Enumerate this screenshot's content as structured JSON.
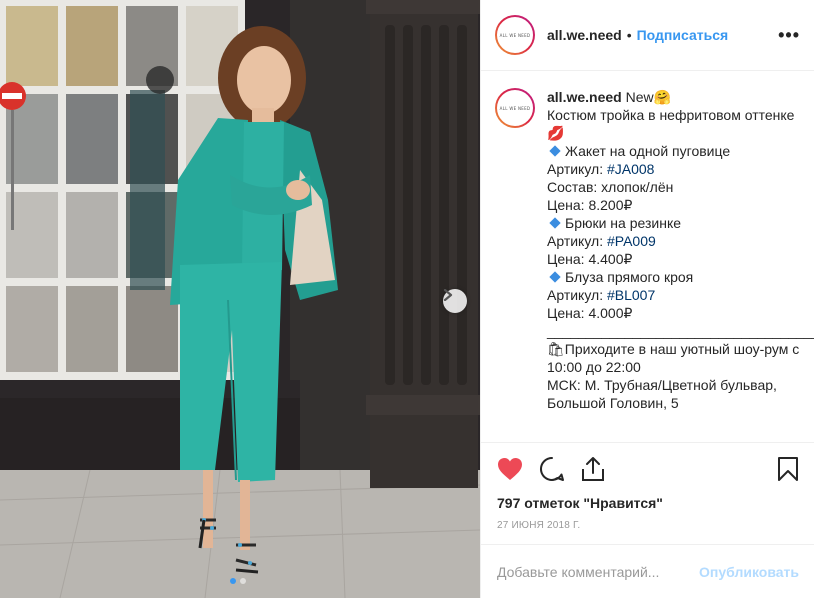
{
  "post": {
    "username": "all.we.need",
    "avatar_text": "ALL WE NEED",
    "follow_label": "Подписаться",
    "separator": "•",
    "more_label": "•••"
  },
  "caption": {
    "username": "all.we.need",
    "lines": [
      {
        "text": "New🤗"
      },
      {
        "text": "Костюм тройка в нефритовом оттенке💋"
      },
      {
        "text": "Жакет на одной пуговице",
        "bullet": "diamond"
      },
      {
        "prefix": "Артикул: ",
        "tag": "#JA008"
      },
      {
        "text": "Состав: хлопок/лён"
      },
      {
        "text": "Цена: 8.200₽"
      },
      {
        "text": "Брюки на резинке",
        "bullet": "diamond"
      },
      {
        "prefix": "Артикул: ",
        "tag": "#PA009"
      },
      {
        "text": "Цена: 4.400₽"
      },
      {
        "text": "Блуза прямого кроя",
        "bullet": "diamond"
      },
      {
        "prefix": "Артикул: ",
        "tag": "#BL007"
      },
      {
        "text": "Цена: 4.000₽"
      },
      {
        "text": "______________________________________"
      },
      {
        "text": "🛍Приходите в наш уютный шоу-рум с 10:00 до 22:00"
      },
      {
        "text": "МСК: М. Трубная/Цветной бульвар, Большой Головин, 5"
      }
    ]
  },
  "actions": {
    "like_icon": "heart-icon",
    "comment_icon": "comment-icon",
    "share_icon": "share-icon",
    "save_icon": "bookmark-icon",
    "likes_text": "797 отметок \"Нравится\"",
    "date": "27 ИЮНЯ 2018 Г."
  },
  "comment_box": {
    "placeholder": "Добавьте комментарий...",
    "publish_label": "Опубликовать"
  },
  "carousel": {
    "slide_count": 2,
    "active_slide": 1
  },
  "colors": {
    "like_red": "#ed4956",
    "link_blue": "#3897f0",
    "hashtag": "#003569",
    "suit_teal": "#2fb3a4"
  }
}
